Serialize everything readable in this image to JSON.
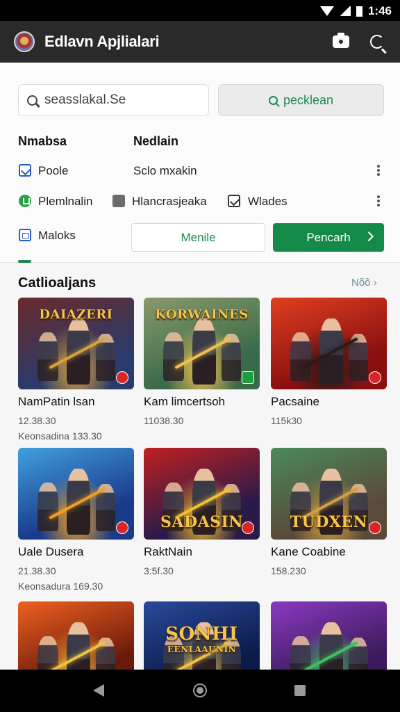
{
  "status_bar": {
    "time": "1:46",
    "icons": [
      "wifi-icon",
      "signal-icon",
      "battery-icon"
    ]
  },
  "app_bar": {
    "title": "Edlavn Apjlialari",
    "icons": [
      "app-logo",
      "camera-icon",
      "refresh-icon"
    ]
  },
  "search": {
    "placeholder": "seasslakal.Se",
    "button_label": "pecklean"
  },
  "filters": {
    "header_left": "Nmabsa",
    "header_right": "Nedlain",
    "row1_left": "Poole",
    "row1_right": "Sclo mxakin",
    "row2_a": "Plemlnalin",
    "row2_b": "Hlancrasjeaka",
    "row2_c": "Wlades",
    "row3_left": "Maloks"
  },
  "actions": {
    "outline_label": "Menile",
    "primary_label": "Pencarh"
  },
  "section": {
    "title": "Catlioaljans",
    "more_label": "Nõõ"
  },
  "cards": [
    {
      "title": "NamPatin lsan",
      "meta1": "12.38.30",
      "meta2": "Keonsadina 133.30",
      "banner": "DAIAZERI",
      "colors": [
        "#2a3a6a",
        "#6a2a2a",
        "#d8a040"
      ]
    },
    {
      "title": "Kam limcertsoh",
      "meta1": "11038.30",
      "meta2": "",
      "banner": "KORWAINES",
      "colors": [
        "#3a6a4a",
        "#8a9a6a",
        "#f0c050"
      ]
    },
    {
      "title": "Pacsaine",
      "meta1": "115k30",
      "meta2": "",
      "banner": "",
      "colors": [
        "#8a1010",
        "#e04020",
        "#2a1a1a"
      ]
    },
    {
      "title": "Uale Dusera",
      "meta1": "21.38.30",
      "meta2": "Keonsadura 169.30",
      "banner": "",
      "colors": [
        "#1a3a8a",
        "#40a0e0",
        "#f0a020"
      ]
    },
    {
      "title": "RaktNain",
      "meta1": "3:5f.30",
      "meta2": "",
      "banner": "SADASIN",
      "colors": [
        "#2a1a4a",
        "#c02020",
        "#f0c030"
      ]
    },
    {
      "title": "Kane Coabine",
      "meta1": "158.230",
      "meta2": "",
      "banner": "TUDXEN",
      "colors": [
        "#5a4a3a",
        "#4a8a5a",
        "#d0a040"
      ]
    },
    {
      "title": "",
      "meta1": "",
      "meta2": "",
      "banner": "",
      "colors": [
        "#6a1a0a",
        "#f06020",
        "#f0c040"
      ]
    },
    {
      "title": "",
      "meta1": "",
      "meta2": "",
      "banner": "SONHI",
      "colors": [
        "#0a1a4a",
        "#2a4a9a",
        "#f0c040"
      ]
    },
    {
      "title": "",
      "meta1": "",
      "meta2": "",
      "banner": "",
      "colors": [
        "#3a1a5a",
        "#8a3ac0",
        "#40c060"
      ]
    }
  ],
  "card_subbanners": {
    "card7": "EENLAAUNIN"
  },
  "nav_bar": {
    "icons": [
      "back-icon",
      "home-icon",
      "recents-icon"
    ]
  },
  "theme": {
    "accent_green": "#138a48",
    "appbar": "#2a2a2a"
  }
}
